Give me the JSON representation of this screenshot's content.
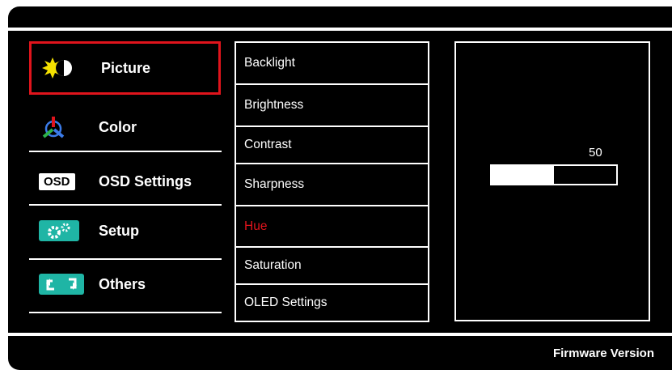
{
  "menu": [
    {
      "label": "Picture",
      "icon": "picture-icon",
      "selected": true
    },
    {
      "label": "Color",
      "icon": "color-icon"
    },
    {
      "label": "OSD Settings",
      "icon": "osd-icon",
      "badge": "OSD"
    },
    {
      "label": "Setup",
      "icon": "gears-icon"
    },
    {
      "label": "Others",
      "icon": "others-icon"
    }
  ],
  "submenu": [
    {
      "label": "Backlight"
    },
    {
      "label": "Brightness"
    },
    {
      "label": "Contrast"
    },
    {
      "label": "Sharpness"
    },
    {
      "label": "Hue",
      "active": true
    },
    {
      "label": "Saturation"
    },
    {
      "label": "OLED Settings"
    }
  ],
  "value": {
    "number": "50",
    "level_percent": 50
  },
  "footer": {
    "firmware_label": "Firmware Version"
  },
  "colors": {
    "background": "#000000",
    "foreground": "#ffffff",
    "highlight": "#e0141c",
    "icon_teal": "#1fb5a5",
    "icon_yellow": "#f5e100"
  }
}
